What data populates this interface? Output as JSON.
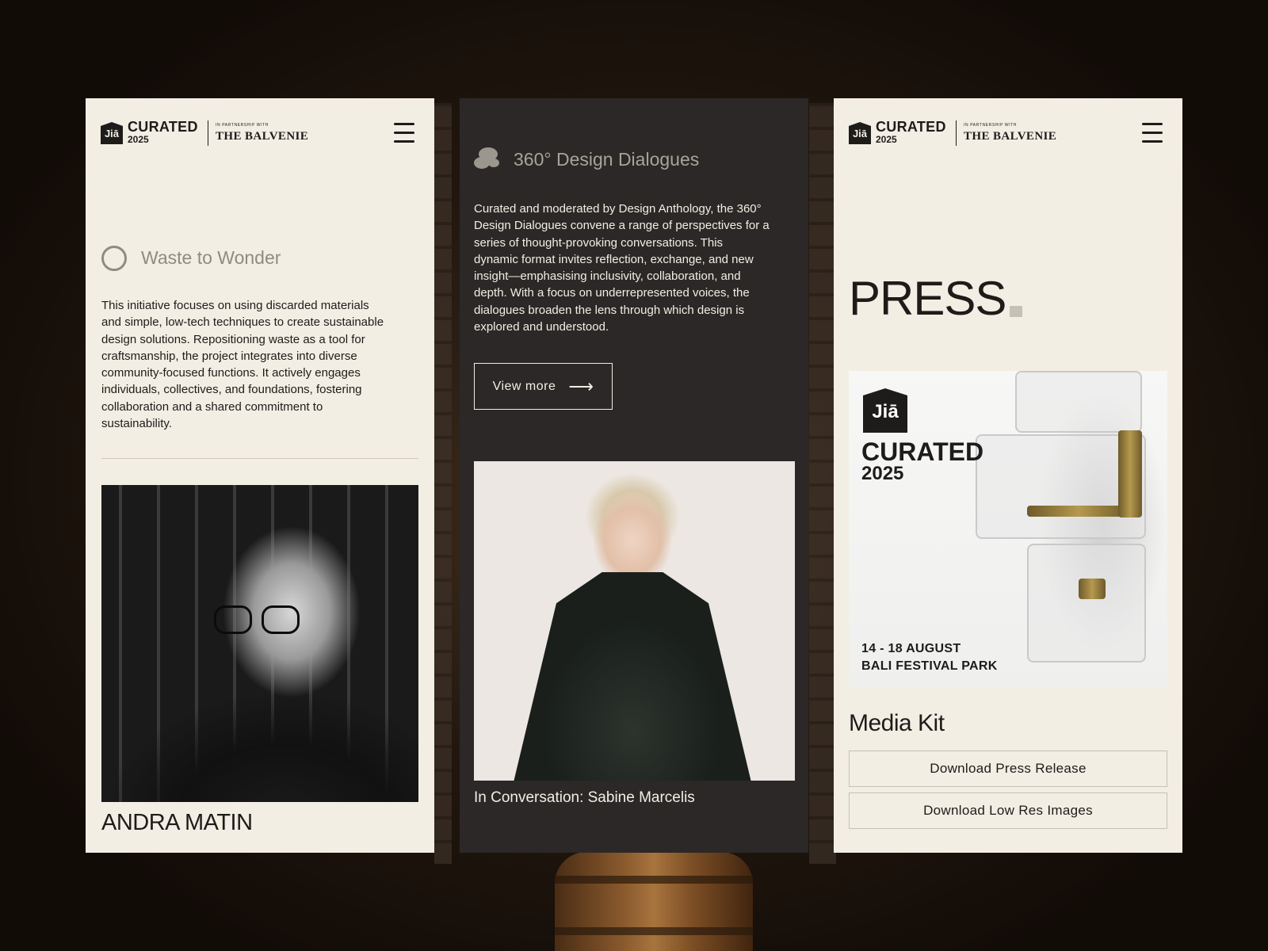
{
  "brand": {
    "logo_mark": "Jiā",
    "curated": "CURATED",
    "year": "2025",
    "partnership": "IN PARTNERSHIP WITH",
    "partner": "THE BALVENIE"
  },
  "panel1": {
    "section_title": "Waste to Wonder",
    "body_lines": [
      "This initiative focuses on using discarded materials",
      "and simple, low-tech techniques to create sustainable",
      "design solutions. Repositioning waste as a tool for",
      "craftsmanship, the project integrates into diverse",
      "community-focused functions. It actively engages",
      "individuals, collectives, and foundations, fostering",
      "collaboration and a shared commitment to",
      "sustainability."
    ],
    "person_name": "ANDRA MATIN"
  },
  "panel2": {
    "section_title": "360° Design Dialogues",
    "body_lines": [
      "Curated and moderated by Design Anthology, the 360°",
      "Design Dialogues convene a range of perspectives for a",
      "series of thought-provoking conversations. This",
      "dynamic format invites reflection, exchange, and new",
      "insight—emphasising inclusivity, collaboration, and",
      "depth. With a focus on underrepresented voices, the",
      "dialogues broaden the lens through which design is",
      "explored and understood."
    ],
    "button_label": "View more",
    "caption": "In Conversation: Sabine Marcelis"
  },
  "panel3": {
    "heading": "PRESS",
    "poster": {
      "logo_mark": "Jiā",
      "curated": "CURATED",
      "year": "2025",
      "date_line": "14 - 18 AUGUST",
      "venue_line": "BALI FESTIVAL PARK"
    },
    "media_kit_title": "Media Kit",
    "buttons": [
      "Download Press Release",
      "Download Low Res Images"
    ]
  },
  "colors": {
    "cream": "#f2eee3",
    "charcoal": "#2b2827",
    "ink": "#1e1c1a",
    "muted_gray": "#8f8b82"
  },
  "icons": [
    "circle-ring-icon",
    "speech-bubbles-icon",
    "arrow-right-icon",
    "hamburger-menu-icon"
  ]
}
